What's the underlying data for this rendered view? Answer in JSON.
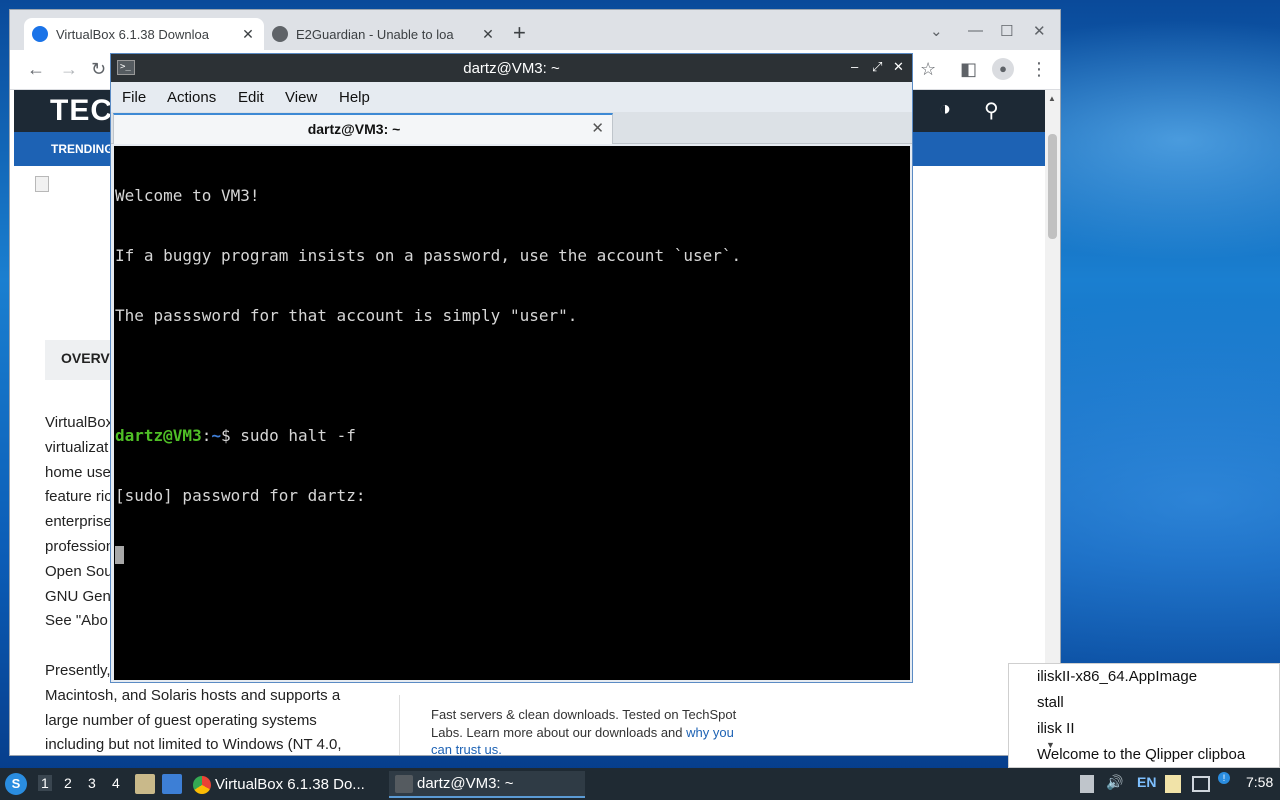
{
  "browser": {
    "tabs": [
      {
        "title": "VirtualBox 6.1.38 Downloa",
        "active": true,
        "favicon_color": "#1a73e8"
      },
      {
        "title": "E2Guardian - Unable to loa",
        "active": false,
        "favicon_color": "#5f6368"
      }
    ],
    "new_tab": "+",
    "tab_close": "✕",
    "window_controls": {
      "menu": "⌄",
      "minimize": "—",
      "maximize": "☐",
      "close": "✕"
    },
    "nav": {
      "back": "←",
      "forward": "→",
      "reload": "↻",
      "bookmark": "☆",
      "profile": "●",
      "more": "⋮",
      "sidepanel": "◧"
    },
    "page": {
      "logo": "TEC",
      "nav_item": "TRENDING",
      "header_icons": {
        "theme": "◑",
        "search": "⚲"
      },
      "overview_tab": "OVERVI",
      "article_lines": [
        "VirtualBox",
        "virtualizat",
        "home use",
        "feature ric",
        "enterprise",
        "profession",
        "Open Sou",
        "GNU Gen",
        "See \"Abo"
      ],
      "article_para2": [
        "Presently,",
        "Macintosh, and Solaris hosts and supports a",
        "large number of guest operating systems",
        "including but not limited to Windows (NT 4.0,"
      ],
      "sidebar_note": {
        "text": "Fast servers & clean downloads. Tested on TechSpot Labs. Learn more about our downloads and ",
        "link": "why you can trust us."
      }
    }
  },
  "terminal": {
    "title": "dartz@VM3: ~",
    "icon_glyph": ">_",
    "controls": {
      "minimize": "–",
      "maximize": "⤢",
      "close": "✕"
    },
    "menu": [
      "File",
      "Actions",
      "Edit",
      "View",
      "Help"
    ],
    "tab_label": "dartz@VM3: ~",
    "tab_close": "✕",
    "lines": [
      "Welcome to VM3!",
      "If a buggy program insists on a password, use the account `user`.",
      "The passsword for that account is simply \"user\".",
      ""
    ],
    "prompt": {
      "user": "dartz@VM3",
      "sep": ":",
      "path": "~",
      "symbol": "$ ",
      "command": "sudo halt -f"
    },
    "sudo_prompt": "[sudo] password for dartz:"
  },
  "clipboard_popup": {
    "items": [
      "iliskII-x86_64.AppImage",
      "stall",
      "ilisk II",
      "Welcome to the Qlipper clipboa"
    ]
  },
  "taskbar": {
    "start_glyph": "S",
    "workspaces": [
      "1",
      "2",
      "3",
      "4"
    ],
    "active_workspace": "1",
    "tasks": [
      {
        "label": "VirtualBox 6.1.38 Do...",
        "active": false
      },
      {
        "label": "dartz@VM3: ~",
        "active": true
      }
    ],
    "tray": {
      "keyboard_layout": "EN",
      "time": "7:58",
      "volume": "🔊",
      "notification_badge": "!"
    }
  }
}
